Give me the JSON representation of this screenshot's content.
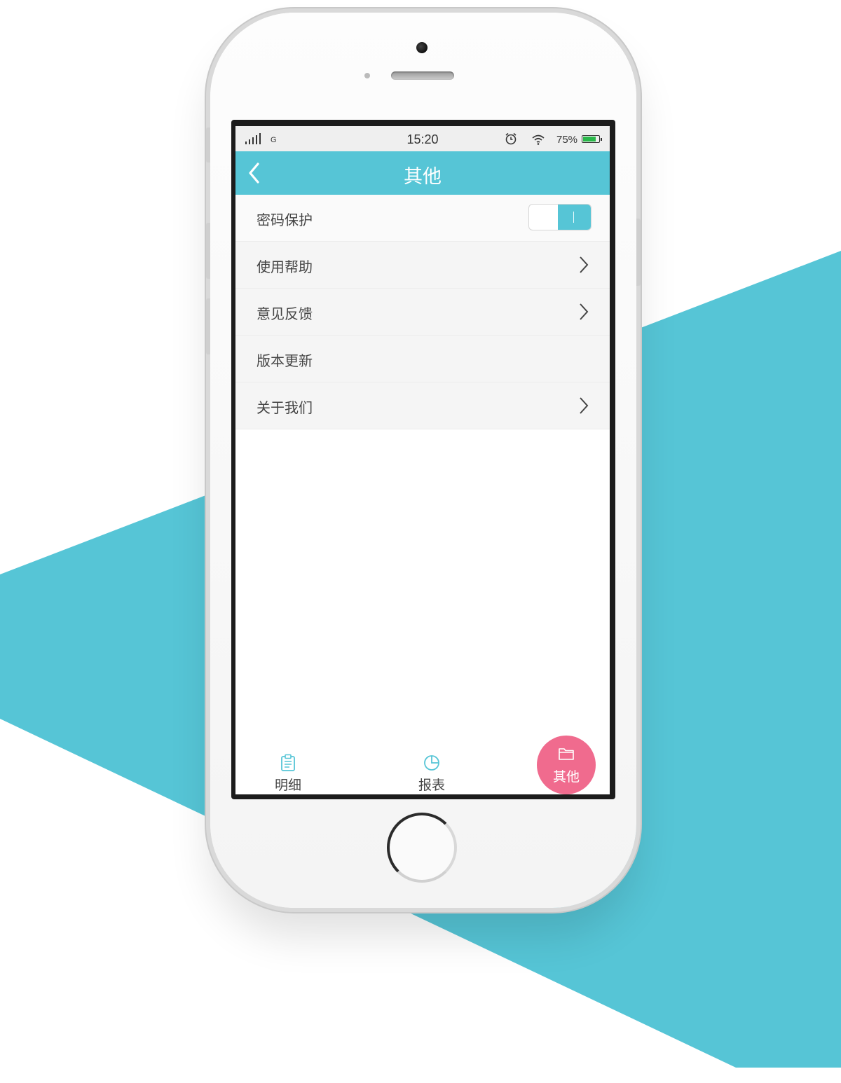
{
  "colors": {
    "accent": "#56c5d6",
    "fab": "#f06b8e",
    "background_band": "#56c5d6"
  },
  "status_bar": {
    "network": "G",
    "time": "15:20",
    "battery_percent": "75%",
    "icons": [
      "signal-icon",
      "alarm-icon",
      "wifi-icon",
      "battery-icon"
    ]
  },
  "header": {
    "back_icon": "chevron-left-icon",
    "title": "其他"
  },
  "settings": {
    "items": [
      {
        "label": "密码保护",
        "control": "toggle",
        "toggle_on": true
      },
      {
        "label": "使用帮助",
        "control": "chevron-right-icon"
      },
      {
        "label": "意见反馈",
        "control": "chevron-right-icon"
      },
      {
        "label": "版本更新",
        "control": "none"
      },
      {
        "label": "关于我们",
        "control": "chevron-right-icon"
      }
    ]
  },
  "tabbar": {
    "tabs": [
      {
        "label": "明细",
        "icon": "clipboard-icon",
        "active": false
      },
      {
        "label": "报表",
        "icon": "pie-chart-icon",
        "active": false
      },
      {
        "label": "其他",
        "icon": "folder-icon",
        "active": true
      }
    ]
  }
}
